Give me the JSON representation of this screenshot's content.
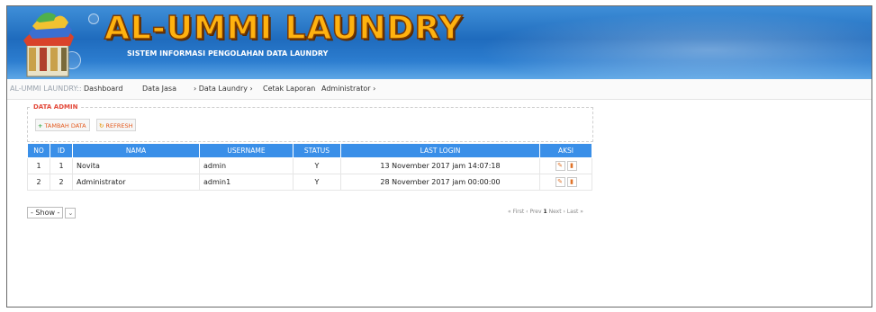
{
  "header": {
    "title": "AL-UMMI LAUNDRY",
    "subtitle": "SISTEM INFORMASI PENGOLAHAN DATA LAUNDRY"
  },
  "nav": {
    "brand": "AL-UMMI LAUNDRY::",
    "items": [
      "Dashboard",
      "Data Jasa",
      "› Data Laundry ›",
      "Cetak Laporan",
      "Administrator ›"
    ]
  },
  "section": {
    "legend": "DATA ADMIN",
    "add_label": "TAMBAH DATA",
    "refresh_label": "REFRESH"
  },
  "table": {
    "columns": [
      "NO",
      "ID",
      "NAMA",
      "USERNAME",
      "STATUS",
      "LAST LOGIN",
      "AKSI"
    ],
    "rows": [
      {
        "no": "1",
        "id": "1",
        "nama": "Novita",
        "username": "admin",
        "status": "Y",
        "last_login": "13 November 2017 jam 14:07:18"
      },
      {
        "no": "2",
        "id": "2",
        "nama": "Administrator",
        "username": "admin1",
        "status": "Y",
        "last_login": "28 November 2017 jam 00:00:00"
      }
    ]
  },
  "pager": {
    "show_label": "- Show -",
    "first": "« First",
    "prev": "‹ Prev",
    "current": "1",
    "next": "Next ›",
    "last": "Last »"
  },
  "colors": {
    "header_blue": "#1f6bbd",
    "title_orange": "#ffb20f",
    "table_header": "#3a8fe8",
    "legend_red": "#e34a3b"
  }
}
